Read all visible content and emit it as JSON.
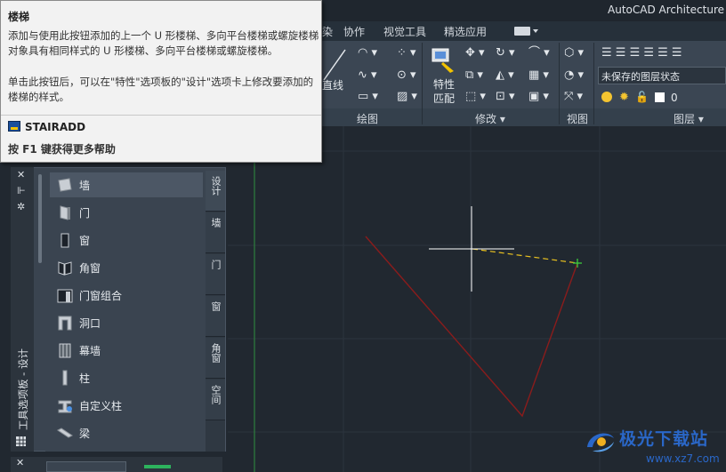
{
  "app": {
    "title": "AutoCAD Architecture"
  },
  "ribbon": {
    "tabs": [
      {
        "label": "染"
      },
      {
        "label": "协作"
      },
      {
        "label": "视觉工具"
      },
      {
        "label": "精选应用"
      }
    ],
    "draw_line_label": "直线",
    "modify_props_label_1": "特性",
    "modify_props_label_2": "匹配",
    "panels": {
      "draw": "绘图",
      "modify": "修改",
      "view": "视图",
      "layers": "图层"
    },
    "layer_state": "未保存的图层状态",
    "current_layer": "0"
  },
  "tooltip": {
    "title": "楼梯",
    "body": "添加与使用此按钮添加的上一个 U 形楼梯、多向平台楼梯或螺旋楼梯对象具有相同样式的 U 形楼梯、多向平台楼梯或螺旋楼梯。",
    "body2": "单击此按钮后，可以在\"特性\"选项板的\"设计\"选项卡上修改要添加的楼梯的样式。",
    "command": "STAIRADD",
    "help": "按 F1 键获得更多帮助"
  },
  "palette": {
    "title": "工具选项板 - 设计",
    "items": [
      {
        "label": "墙",
        "icon": "wall-icon"
      },
      {
        "label": "门",
        "icon": "door-icon"
      },
      {
        "label": "窗",
        "icon": "window-icon"
      },
      {
        "label": "角窗",
        "icon": "corner-window-icon"
      },
      {
        "label": "门窗组合",
        "icon": "door-window-assembly-icon"
      },
      {
        "label": "洞口",
        "icon": "opening-icon"
      },
      {
        "label": "幕墙",
        "icon": "curtain-wall-icon"
      },
      {
        "label": "柱",
        "icon": "column-icon"
      },
      {
        "label": "自定义柱",
        "icon": "custom-column-icon"
      },
      {
        "label": "梁",
        "icon": "beam-icon"
      }
    ],
    "tabs": [
      {
        "label": "设计"
      },
      {
        "label": "墙"
      },
      {
        "label": "门"
      },
      {
        "label": "窗"
      },
      {
        "label": "角窗"
      },
      {
        "label": "空间"
      }
    ]
  },
  "watermark": {
    "text": "极光下载站",
    "url": "www.xz7.com"
  },
  "colors": {
    "canvas": "#212830",
    "grid_major": "#3a4350",
    "ucs_green": "#2f8f3f",
    "polyline": "#8a1c1c",
    "rubberband": "#e8c020",
    "crosshair": "#ffffff",
    "endpoint_marker": "#3ccc3c"
  }
}
